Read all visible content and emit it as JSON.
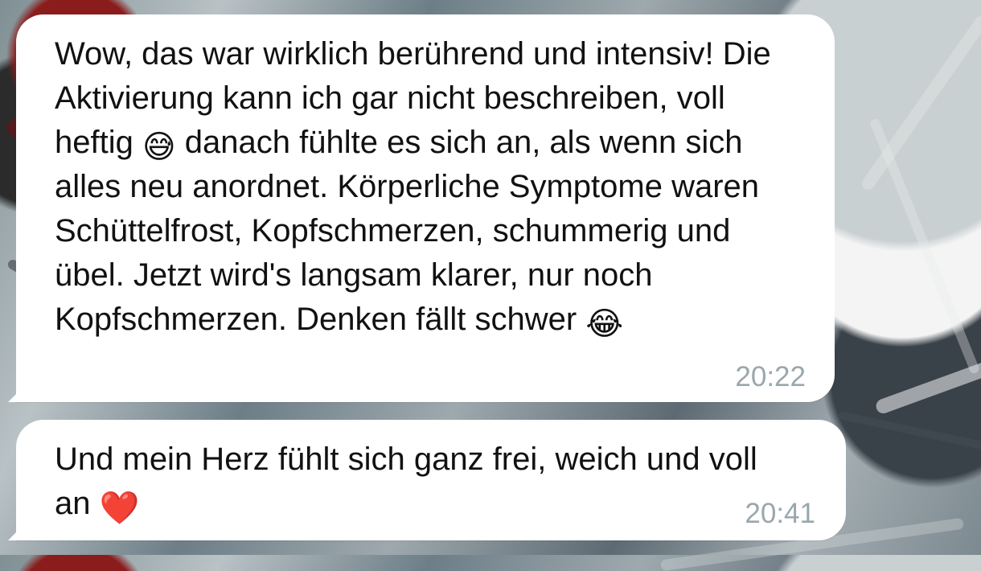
{
  "messages": [
    {
      "text_before_emoji": "Wow, das war wirklich berührend und intensiv! Die Aktivierung kann ich gar nicht beschreiben, voll heftig ",
      "emoji_1": "😅",
      "text_after_emoji": " danach fühlte es sich an, als wenn sich alles neu anordnet. Körperliche Symptome waren Schüttelfrost, Kopfschmerzen, schummerig und übel. Jetzt wird's langsam klarer, nur noch Kopfschmerzen. Denken fällt schwer",
      "emoji_2": "😂",
      "time": "20:22"
    },
    {
      "text_before_emoji": "Und mein Herz fühlt sich ganz frei, weich und voll an ",
      "emoji_1": "❤️",
      "time": "20:41"
    }
  ],
  "icons": {
    "message_1_emoji_1": "sweat-smile-emoji",
    "message_1_emoji_2": "tears-of-joy-emoji",
    "message_2_emoji_1": "red-heart-emoji"
  },
  "colors": {
    "bubble": "#ffffff",
    "text": "#111111",
    "time": "#9aa7ad"
  }
}
